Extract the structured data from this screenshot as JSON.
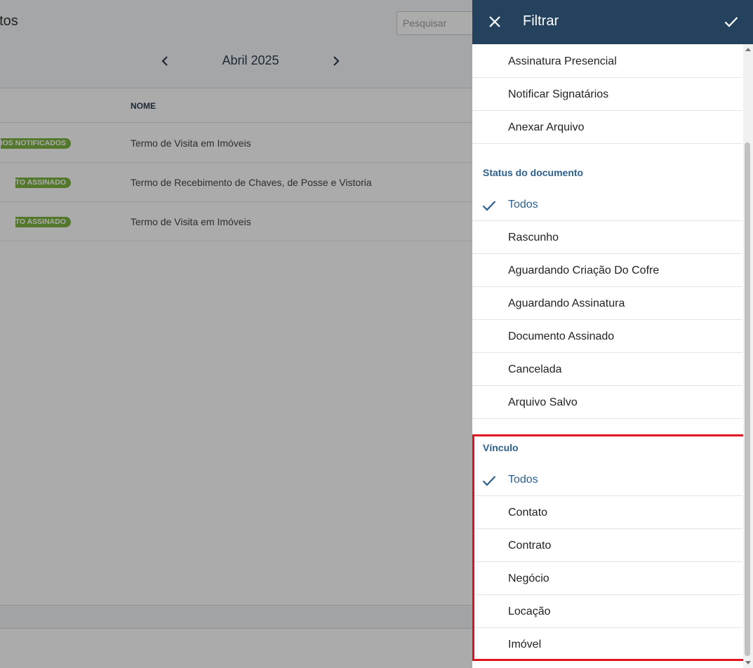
{
  "page": {
    "title": "ntos",
    "search_placeholder": "Pesquisar",
    "month": "Abril 2025",
    "table": {
      "column_name": "NOME",
      "rows": [
        {
          "status": "IOS NOTIFICADOS",
          "name": "Termo de Visita em Imóveis"
        },
        {
          "status": "TO ASSINADO",
          "name": "Termo de Recebimento de Chaves, de Posse e Vistoria"
        },
        {
          "status": "TO ASSINADO",
          "name": "Termo de Visita em Imóveis"
        }
      ]
    },
    "colors": {
      "badge": "#7cb342",
      "header": "#24425e",
      "accent": "#2b5f8e",
      "highlight": "#e0141e"
    }
  },
  "drawer": {
    "title": "Filtrar",
    "close_icon": "close-icon",
    "confirm_icon": "check-icon",
    "top_items": [
      "Assinatura Presencial",
      "Notificar Signatários",
      "Anexar Arquivo"
    ],
    "status_section": {
      "title": "Status do documento",
      "items": [
        "Todos",
        "Rascunho",
        "Aguardando Criação Do Cofre",
        "Aguardando Assinatura",
        "Documento Assinado",
        "Cancelada",
        "Arquivo Salvo"
      ],
      "selected": "Todos"
    },
    "vinculo_section": {
      "title": "Vínculo",
      "items": [
        "Todos",
        "Contato",
        "Contrato",
        "Negócio",
        "Locação",
        "Imóvel"
      ],
      "selected": "Todos"
    }
  }
}
